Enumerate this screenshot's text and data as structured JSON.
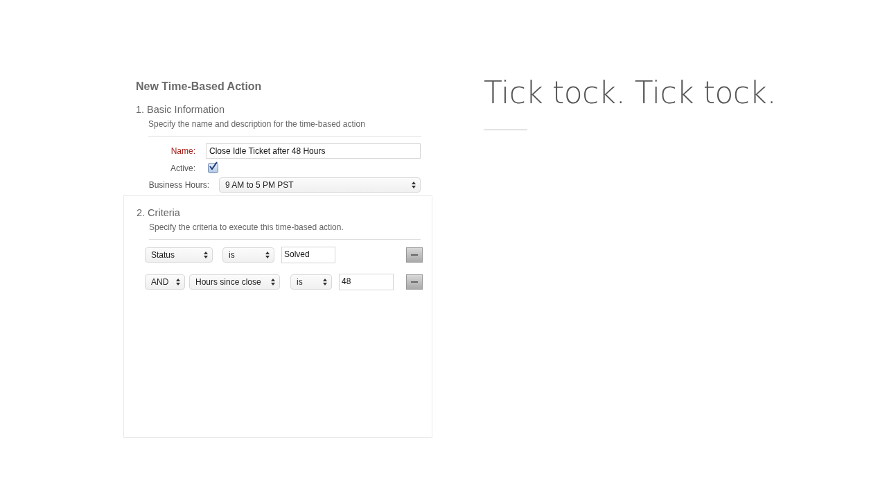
{
  "form": {
    "title": "New Time-Based Action",
    "basic": {
      "heading": "1. Basic Information",
      "description": "Specify the name and description for the time-based action",
      "name": {
        "label": "Name:",
        "value": "Close Idle Ticket after 48 Hours"
      },
      "active": {
        "label": "Active:",
        "checked": true
      },
      "business_hours": {
        "label": "Business Hours:",
        "value": "9 AM to 5 PM PST"
      }
    },
    "criteria": {
      "heading": "2. Criteria",
      "description": "Specify the criteria to execute this time-based action.",
      "rows": [
        {
          "fields": [
            {
              "kind": "select",
              "value": "Status"
            },
            {
              "kind": "select",
              "value": "is"
            },
            {
              "kind": "input",
              "value": "Solved"
            }
          ]
        },
        {
          "fields": [
            {
              "kind": "select",
              "value": "AND"
            },
            {
              "kind": "select",
              "value": "Hours since close"
            },
            {
              "kind": "select",
              "value": "is"
            },
            {
              "kind": "input",
              "value": "48"
            }
          ]
        }
      ]
    }
  },
  "headline": "Tick tock. Tick tock."
}
